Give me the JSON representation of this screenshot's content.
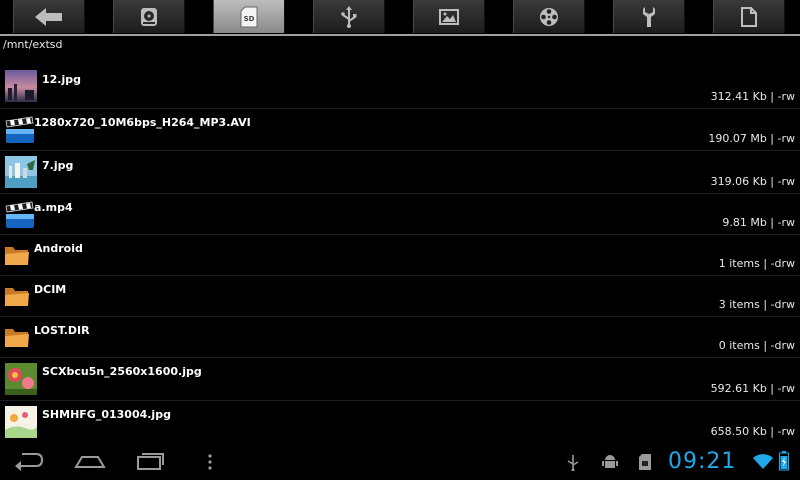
{
  "toolbar": {
    "tabs": [
      {
        "name": "back-tab",
        "icon": "back-arrow-icon"
      },
      {
        "name": "internal-storage-tab",
        "icon": "internal-storage-icon"
      },
      {
        "name": "sd-card-tab",
        "icon": "sd-card-icon",
        "label": "SD",
        "active": true
      },
      {
        "name": "usb-tab",
        "icon": "usb-icon"
      },
      {
        "name": "pictures-tab",
        "icon": "picture-icon"
      },
      {
        "name": "videos-tab",
        "icon": "film-reel-icon"
      },
      {
        "name": "tools-tab",
        "icon": "wrench-icon"
      },
      {
        "name": "documents-tab",
        "icon": "document-icon"
      }
    ]
  },
  "path": "/mnt/extsd",
  "files": [
    {
      "name": "12.jpg",
      "meta": "312.41 Kb  | -rw",
      "icon": "image-thumbnail"
    },
    {
      "name": "1280x720_10M6bps_H264_MP3.AVI",
      "meta": "190.07 Mb  | -rw",
      "icon": "video-clapper-icon"
    },
    {
      "name": "7.jpg",
      "meta": "319.06 Kb  | -rw",
      "icon": "image-thumbnail"
    },
    {
      "name": "a.mp4",
      "meta": "9.81 Mb  | -rw",
      "icon": "video-clapper-icon"
    },
    {
      "name": "Android",
      "meta": "1 items | -drw",
      "icon": "folder-icon"
    },
    {
      "name": "DCIM",
      "meta": "3 items | -drw",
      "icon": "folder-icon"
    },
    {
      "name": "LOST.DIR",
      "meta": "0 items | -drw",
      "icon": "folder-icon"
    },
    {
      "name": "SCXbcu5n_2560x1600.jpg",
      "meta": "592.61 Kb  | -rw",
      "icon": "image-thumbnail"
    },
    {
      "name": "SHMHFG_013004.jpg",
      "meta": "658.50 Kb  | -rw",
      "icon": "image-thumbnail"
    }
  ],
  "status": {
    "time": "09:21",
    "accent": "#1fa9e8",
    "icons": [
      "usb-debug-icon",
      "android-debug-icon",
      "sd-card-status-icon",
      "wifi-icon",
      "battery-icon"
    ]
  },
  "nav": {
    "buttons": [
      "back-nav-icon",
      "home-nav-icon",
      "recent-apps-icon",
      "menu-icon"
    ]
  }
}
